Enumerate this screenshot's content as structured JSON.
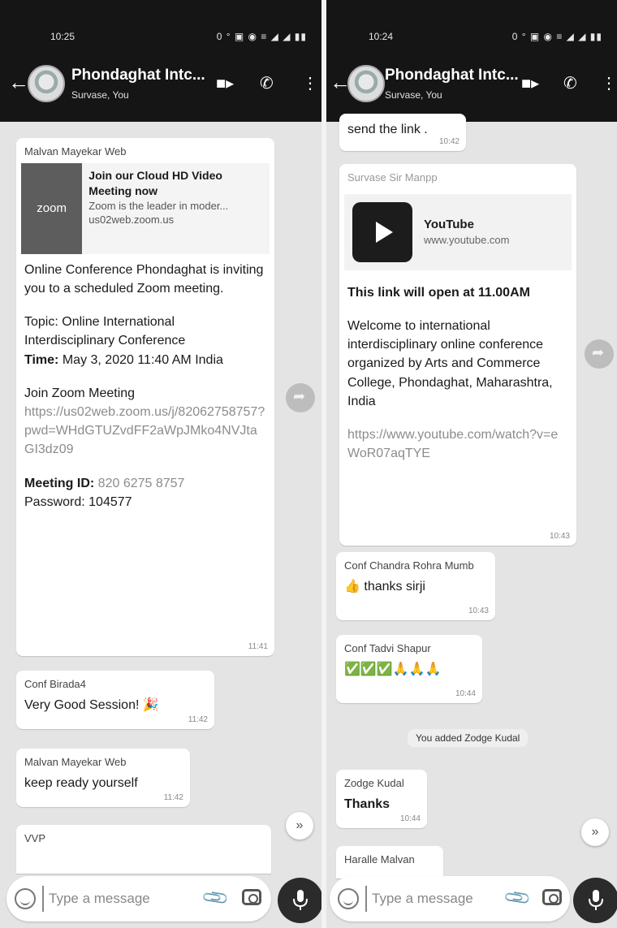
{
  "left": {
    "status": {
      "time": "10:25",
      "icons": "0 ° ▣  ◉ ≡ ◢ ◢ ▮▮"
    },
    "header": {
      "title": "Phondaghat Intc...",
      "subtitle": "Survase, You"
    },
    "messages": {
      "zoom_invite": {
        "sender": "Malvan Mayekar Web",
        "preview_thumb": "zoom",
        "preview_title": "Join our Cloud HD Video Meeting now",
        "preview_desc": "Zoom is the leader in moder...",
        "preview_domain": "us02web.zoom.us",
        "intro": "Online Conference Phondaghat is inviting you to a scheduled Zoom meeting.",
        "topic_label": "Topic:",
        "topic": "Online International Interdisciplinary Conference",
        "time_label": "Time:",
        "time": "May 3, 2020 11:40 AM India",
        "join": "Join Zoom Meeting",
        "link": "https://us02web.zoom.us/j/82062758757?pwd=WHdGTUZvdFF2aWpJMko4NVJtaGI3dz09",
        "meeting_id_label": "Meeting ID:",
        "meeting_id": "820 6275 8757",
        "password_label": "Password:",
        "password": "104577",
        "time_sent": "11:41"
      },
      "birada": {
        "sender": "Conf Birada4",
        "text": "Very Good Session! 🎉",
        "time_sent": "11:42"
      },
      "malvan2": {
        "sender": "Malvan Mayekar Web",
        "text": "keep ready yourself",
        "time_sent": "11:42"
      },
      "vvp": {
        "sender": "VVP"
      }
    },
    "input": {
      "placeholder": "Type a message"
    }
  },
  "right": {
    "status": {
      "time": "10:24",
      "icons": "0 ° ▣  ◉ ≡ ◢ ◢ ▮▮"
    },
    "header": {
      "title": "Phondaghat Intc...",
      "subtitle": "Survase, You"
    },
    "messages": {
      "send_link": {
        "text": "send the link .",
        "time_sent": "10:42"
      },
      "youtube": {
        "sender": "Survase Sir Manpp",
        "yt_title": "YouTube",
        "yt_domain": "www.youtube.com",
        "headline": "This link will open at 11.00AM",
        "body": "Welcome to international interdisciplinary online conference organized by Arts and Commerce College, Phondaghat, Maharashtra, India",
        "link": "https://www.youtube.com/watch?v=eWoR07aqTYE",
        "time_sent": "10:43"
      },
      "chandra": {
        "sender": "Conf Chandra Rohra Mumb",
        "text": "👍 thanks sirji",
        "time_sent": "10:43"
      },
      "tadvi": {
        "sender": "Conf Tadvi Shapur",
        "text": "✅✅✅🙏🙏🙏",
        "time_sent": "10:44"
      },
      "system": {
        "text": "You added Zodge Kudal"
      },
      "zodge": {
        "sender": "Zodge Kudal",
        "text": "Thanks",
        "time_sent": "10:44"
      },
      "haralle": {
        "sender": "Haralle Malvan"
      }
    },
    "input": {
      "placeholder": "Type a message"
    }
  },
  "icons": [
    "back-arrow-icon",
    "video-call-icon",
    "voice-call-icon",
    "more-options-icon",
    "forward-icon",
    "scroll-down-icon",
    "emoji-icon",
    "attach-icon",
    "camera-icon",
    "mic-icon",
    "youtube-play-icon"
  ]
}
